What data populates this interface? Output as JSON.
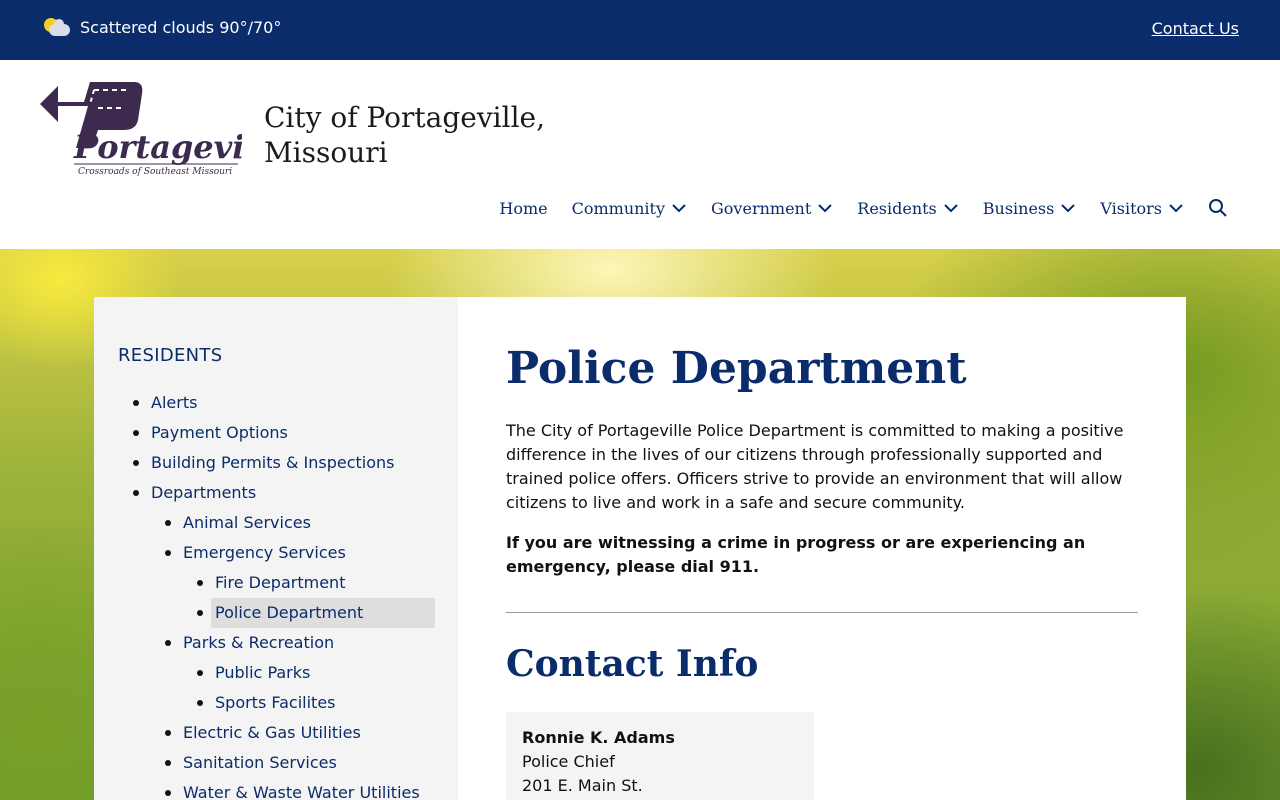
{
  "topbar": {
    "weather_text": "Scattered clouds 90°/70°",
    "weather_icon": "partly-cloudy-icon",
    "contact_label": "Contact Us",
    "background": "#0b2c6b"
  },
  "header": {
    "logo_text": "Portageville",
    "logo_tagline": "Crossroads of Southeast Missouri",
    "site_title": "City of Portageville, Missouri",
    "nav": [
      {
        "label": "Home"
      },
      {
        "label": "Community"
      },
      {
        "label": "Government"
      },
      {
        "label": "Residents"
      },
      {
        "label": "Business"
      },
      {
        "label": "Visitors"
      }
    ],
    "search_icon": "search-icon"
  },
  "sidebar": {
    "title": "RESIDENTS",
    "items": [
      {
        "label": "Alerts"
      },
      {
        "label": "Payment Options"
      },
      {
        "label": "Building Permits & Inspections"
      },
      {
        "label": "Departments"
      },
      {
        "label": "Animal Services"
      },
      {
        "label": "Emergency Services"
      },
      {
        "label": "Fire Department"
      },
      {
        "label": "Police Department"
      },
      {
        "label": "Parks & Recreation"
      },
      {
        "label": "Public Parks"
      },
      {
        "label": "Sports Facilites"
      },
      {
        "label": "Electric & Gas Utilities"
      },
      {
        "label": "Sanitation Services"
      },
      {
        "label": "Water & Waste Water Utilities"
      }
    ],
    "active_item": "Police Department"
  },
  "main": {
    "page_title": "Police Department",
    "intro": "The City of Portageville Police Department is committed to making a positive difference in the lives of our citizens through professionally supported and trained police offers. Officers strive to provide an environment that will allow citizens to live and work in a safe and secure community.",
    "emergency_notice": "If you are witnessing a crime in progress or are experiencing an emergency, please dial 911.",
    "contact_title": "Contact Info",
    "contact": {
      "name": "Ronnie K. Adams",
      "role": "Police Chief",
      "address": "201 E. Main St."
    }
  },
  "colors": {
    "brand_navy": "#0b2c6b",
    "sidebar_bg": "#f4f4f4",
    "active_highlight": "#dedede",
    "logo_purple": "#3d2b4f"
  }
}
